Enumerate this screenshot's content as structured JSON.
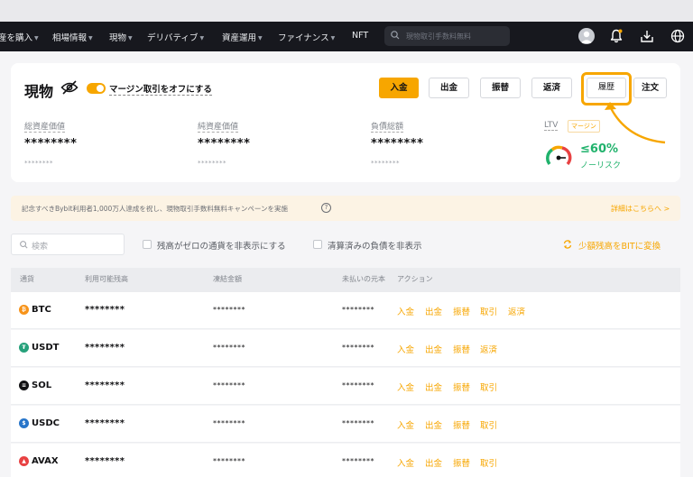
{
  "nav": {
    "items": [
      {
        "label": "産を購入",
        "caret": true
      },
      {
        "label": "相場情報",
        "caret": true
      },
      {
        "label": "現物",
        "caret": true
      },
      {
        "label": "デリバティブ",
        "caret": true
      },
      {
        "label": "資産運用",
        "caret": true
      },
      {
        "label": "ファイナンス",
        "caret": true
      },
      {
        "label": "NFT",
        "caret": false
      }
    ],
    "search_placeholder": "現物取引手数料無料",
    "icons": [
      "avatar",
      "bell-icon",
      "download-icon",
      "globe-icon"
    ]
  },
  "header": {
    "title": "現物",
    "margin_toggle_label": "マージン取引をオフにする",
    "margin_toggle_on": true,
    "buttons": {
      "deposit": "入金",
      "withdraw": "出金",
      "transfer": "振替",
      "repay": "返済",
      "history": "履歴",
      "orders": "注文"
    }
  },
  "metrics": [
    {
      "label": "総資産価値",
      "value": "********",
      "sub": "********"
    },
    {
      "label": "純資産価値",
      "value": "********",
      "sub": "********"
    },
    {
      "label": "負債総額",
      "value": "********",
      "sub": "********"
    }
  ],
  "ltv": {
    "label": "LTV",
    "chip": "マージン",
    "value": "≤60%",
    "risk": "ノーリスク"
  },
  "banner": {
    "text": "記念すべきBybit利用者1,000万人達成を祝し、現物取引手数料無料キャンペーンを実施",
    "help": "?",
    "link": "詳細はこちらへ >"
  },
  "filters": {
    "search_placeholder": "検索",
    "hide_zero": "残高がゼロの通貨を非表示にする",
    "hide_cleared": "清算済みの負債を非表示",
    "convert_small": "少額残高をBITに変換"
  },
  "table": {
    "headers": {
      "currency": "通貨",
      "available": "利用可能残高",
      "frozen": "凍結金額",
      "unpaid": "未払いの元本",
      "actions": "アクション"
    },
    "rows": [
      {
        "coin": "BTC",
        "color": "#f7931a",
        "glyph": "₿",
        "available": "********",
        "frozen": "********",
        "unpaid": "********",
        "actions": [
          "入金",
          "出金",
          "振替",
          "取引",
          "返済"
        ]
      },
      {
        "coin": "USDT",
        "color": "#26a17b",
        "glyph": "₮",
        "available": "********",
        "frozen": "********",
        "unpaid": "********",
        "actions": [
          "入金",
          "出金",
          "振替",
          "返済"
        ]
      },
      {
        "coin": "SOL",
        "color": "#121214",
        "glyph": "≡",
        "available": "********",
        "frozen": "********",
        "unpaid": "********",
        "actions": [
          "入金",
          "出金",
          "振替",
          "取引"
        ]
      },
      {
        "coin": "USDC",
        "color": "#2775ca",
        "glyph": "$",
        "available": "********",
        "frozen": "********",
        "unpaid": "********",
        "actions": [
          "入金",
          "出金",
          "振替",
          "取引"
        ]
      },
      {
        "coin": "AVAX",
        "color": "#e84142",
        "glyph": "▲",
        "available": "********",
        "frozen": "********",
        "unpaid": "********",
        "actions": [
          "入金",
          "出金",
          "振替",
          "取引"
        ]
      }
    ]
  },
  "colors": {
    "accent": "#f7a600",
    "positive": "#20b26c",
    "nav_bg": "#17181e"
  }
}
